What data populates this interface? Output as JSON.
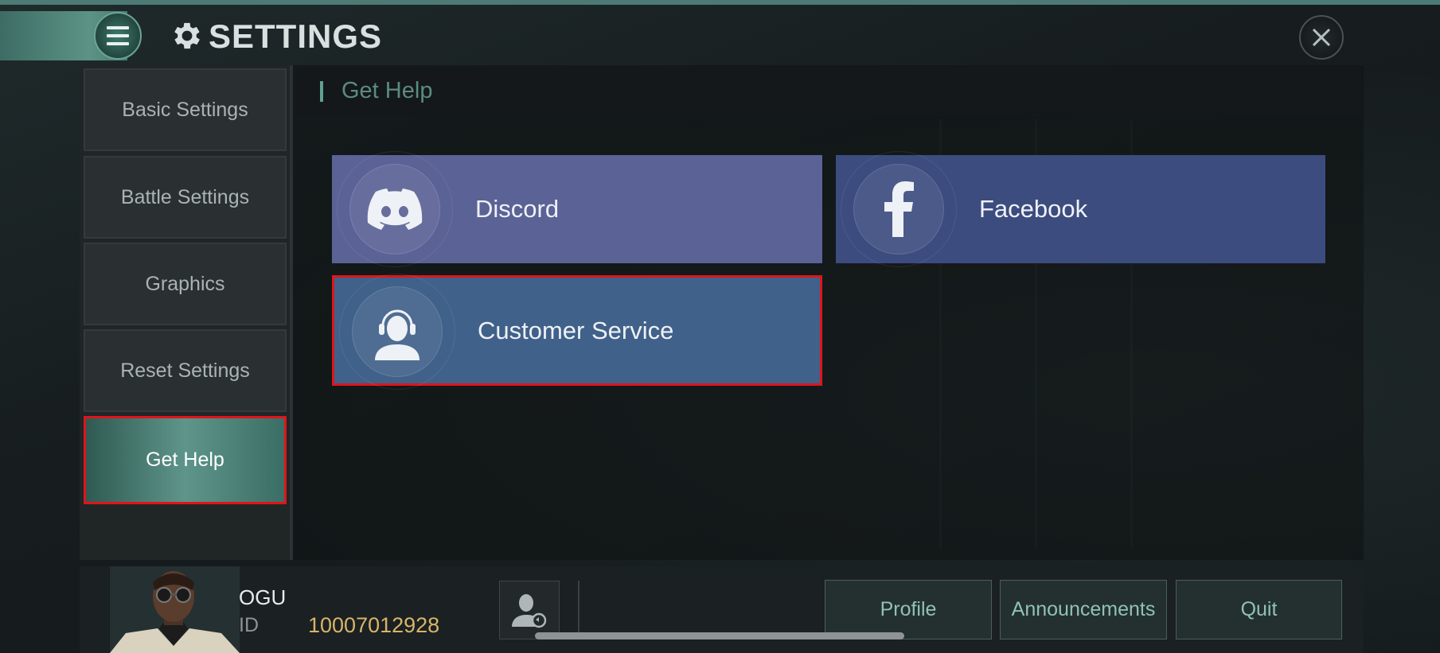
{
  "header": {
    "title": "SETTINGS"
  },
  "sidebar": {
    "items": [
      {
        "label": "Basic Settings"
      },
      {
        "label": "Battle Settings"
      },
      {
        "label": "Graphics"
      },
      {
        "label": "Reset Settings"
      },
      {
        "label": "Get Help",
        "active": true
      }
    ]
  },
  "content": {
    "heading": "Get Help",
    "cards": [
      {
        "label": "Discord",
        "icon": "discord-icon",
        "color": "#5b6296"
      },
      {
        "label": "Facebook",
        "icon": "facebook-icon",
        "color": "#3c4c7f"
      },
      {
        "label": "Customer Service",
        "icon": "headset-user-icon",
        "color": "#406189"
      }
    ]
  },
  "player": {
    "name": "OGU",
    "id_label": "ID",
    "id_value": "10007012928"
  },
  "footer_buttons": {
    "profile": "Profile",
    "announcements": "Announcements",
    "quit": "Quit"
  },
  "colors": {
    "accent": "#5c9386",
    "highlight_border": "#e0141b",
    "id_gold": "#d7b56a"
  }
}
